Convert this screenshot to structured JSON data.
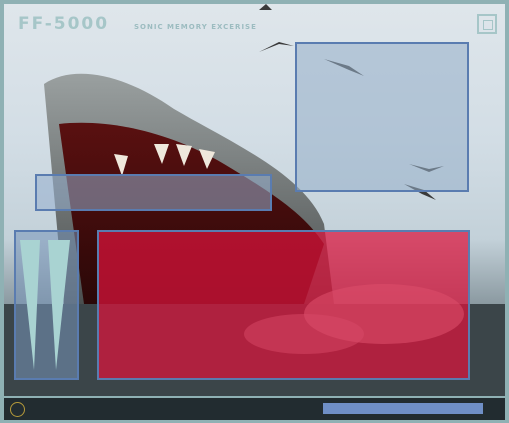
{
  "app": {
    "title": "FF-5000",
    "subtitle": "SONIC MEMORY EXCERISE"
  },
  "icons": {
    "corner": "square-target-icon",
    "circle": "ring-icon"
  },
  "progress": {
    "fraction": 1.0
  },
  "colors": {
    "accent": "#a6c6c8",
    "panel_border": "#5a7cb0",
    "red_panel": "#dc143c",
    "progress": "#6f8fc6"
  }
}
